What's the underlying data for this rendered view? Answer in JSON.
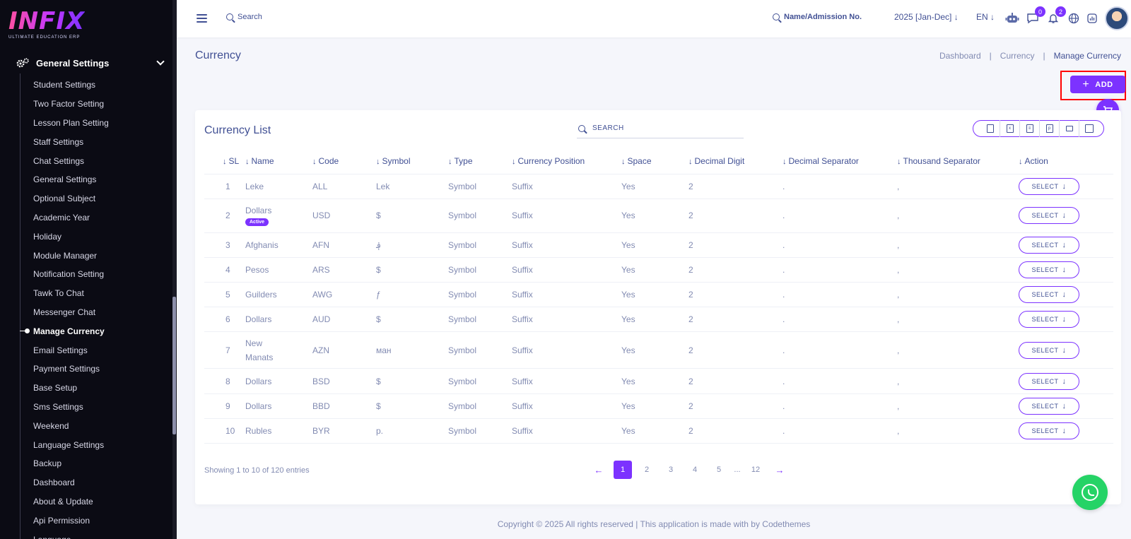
{
  "sidebar": {
    "logo_text": "INFIX",
    "logo_subtitle": "ULTIMATE EDUCATION ERP",
    "group_label": "General Settings",
    "items": [
      {
        "label": "Student Settings"
      },
      {
        "label": "Two Factor Setting"
      },
      {
        "label": "Lesson Plan Setting"
      },
      {
        "label": "Staff Settings"
      },
      {
        "label": "Chat Settings"
      },
      {
        "label": "General Settings"
      },
      {
        "label": "Optional Subject"
      },
      {
        "label": "Academic Year"
      },
      {
        "label": "Holiday"
      },
      {
        "label": "Module Manager"
      },
      {
        "label": "Notification Setting"
      },
      {
        "label": "Tawk To Chat"
      },
      {
        "label": "Messenger Chat"
      },
      {
        "label": "Manage Currency",
        "active": true
      },
      {
        "label": "Email Settings"
      },
      {
        "label": "Payment Settings"
      },
      {
        "label": "Base Setup"
      },
      {
        "label": "Sms Settings"
      },
      {
        "label": "Weekend"
      },
      {
        "label": "Language Settings"
      },
      {
        "label": "Backup"
      },
      {
        "label": "Dashboard"
      },
      {
        "label": "About & Update"
      },
      {
        "label": "Api Permission"
      },
      {
        "label": "Language"
      }
    ]
  },
  "header": {
    "search_placeholder": "Search",
    "admission_search": "Name/Admission No.",
    "academic_year": "2025 [Jan-Dec]",
    "language": "EN",
    "chat_badge": "0",
    "notification_badge": "2"
  },
  "page": {
    "title": "Currency",
    "breadcrumb": [
      "Dashboard",
      "Currency",
      "Manage Currency"
    ],
    "add_label": "ADD"
  },
  "list": {
    "title": "Currency List",
    "search_placeholder": "SEARCH",
    "columns": [
      "SL",
      "Name",
      "Code",
      "Symbol",
      "Type",
      "Currency Position",
      "Space",
      "Decimal Digit",
      "Decimal Separator",
      "Thousand Separator",
      "Action"
    ],
    "rows": [
      {
        "sl": "1",
        "name": "Leke",
        "code": "ALL",
        "symbol": "Lek",
        "type": "Symbol",
        "position": "Suffix",
        "space": "Yes",
        "decimal_digit": "2",
        "decimal_sep": ".",
        "thousand_sep": ","
      },
      {
        "sl": "2",
        "name": "Dollars",
        "badge": "Active",
        "code": "USD",
        "symbol": "$",
        "type": "Symbol",
        "position": "Suffix",
        "space": "Yes",
        "decimal_digit": "2",
        "decimal_sep": ".",
        "thousand_sep": ","
      },
      {
        "sl": "3",
        "name": "Afghanis",
        "code": "AFN",
        "symbol": "؋",
        "type": "Symbol",
        "position": "Suffix",
        "space": "Yes",
        "decimal_digit": "2",
        "decimal_sep": ".",
        "thousand_sep": ","
      },
      {
        "sl": "4",
        "name": "Pesos",
        "code": "ARS",
        "symbol": "$",
        "type": "Symbol",
        "position": "Suffix",
        "space": "Yes",
        "decimal_digit": "2",
        "decimal_sep": ".",
        "thousand_sep": ","
      },
      {
        "sl": "5",
        "name": "Guilders",
        "code": "AWG",
        "symbol": "ƒ",
        "type": "Symbol",
        "position": "Suffix",
        "space": "Yes",
        "decimal_digit": "2",
        "decimal_sep": ".",
        "thousand_sep": ","
      },
      {
        "sl": "6",
        "name": "Dollars",
        "code": "AUD",
        "symbol": "$",
        "type": "Symbol",
        "position": "Suffix",
        "space": "Yes",
        "decimal_digit": "2",
        "decimal_sep": ".",
        "thousand_sep": ","
      },
      {
        "sl": "7",
        "name": "New Manats",
        "code": "AZN",
        "symbol": "ман",
        "type": "Symbol",
        "position": "Suffix",
        "space": "Yes",
        "decimal_digit": "2",
        "decimal_sep": ".",
        "thousand_sep": ","
      },
      {
        "sl": "8",
        "name": "Dollars",
        "code": "BSD",
        "symbol": "$",
        "type": "Symbol",
        "position": "Suffix",
        "space": "Yes",
        "decimal_digit": "2",
        "decimal_sep": ".",
        "thousand_sep": ","
      },
      {
        "sl": "9",
        "name": "Dollars",
        "code": "BBD",
        "symbol": "$",
        "type": "Symbol",
        "position": "Suffix",
        "space": "Yes",
        "decimal_digit": "2",
        "decimal_sep": ".",
        "thousand_sep": ","
      },
      {
        "sl": "10",
        "name": "Rubles",
        "code": "BYR",
        "symbol": "p.",
        "type": "Symbol",
        "position": "Suffix",
        "space": "Yes",
        "decimal_digit": "2",
        "decimal_sep": ".",
        "thousand_sep": ","
      }
    ],
    "select_label": "SELECT",
    "entries_text": "Showing 1 to 10 of 120 entries",
    "pages": [
      "1",
      "2",
      "3",
      "4",
      "5",
      "...",
      "12"
    ],
    "current_page": "1"
  },
  "footer": {
    "text": "Copyright © 2025 All rights reserved | This application is made with by Codethemes"
  },
  "colors": {
    "accent": "#7c32ff",
    "text_primary": "#415094",
    "text_muted": "#828bb2",
    "sidebar_bg": "#0b0b14",
    "whatsapp": "#25d366",
    "highlight": "#ff0000"
  }
}
